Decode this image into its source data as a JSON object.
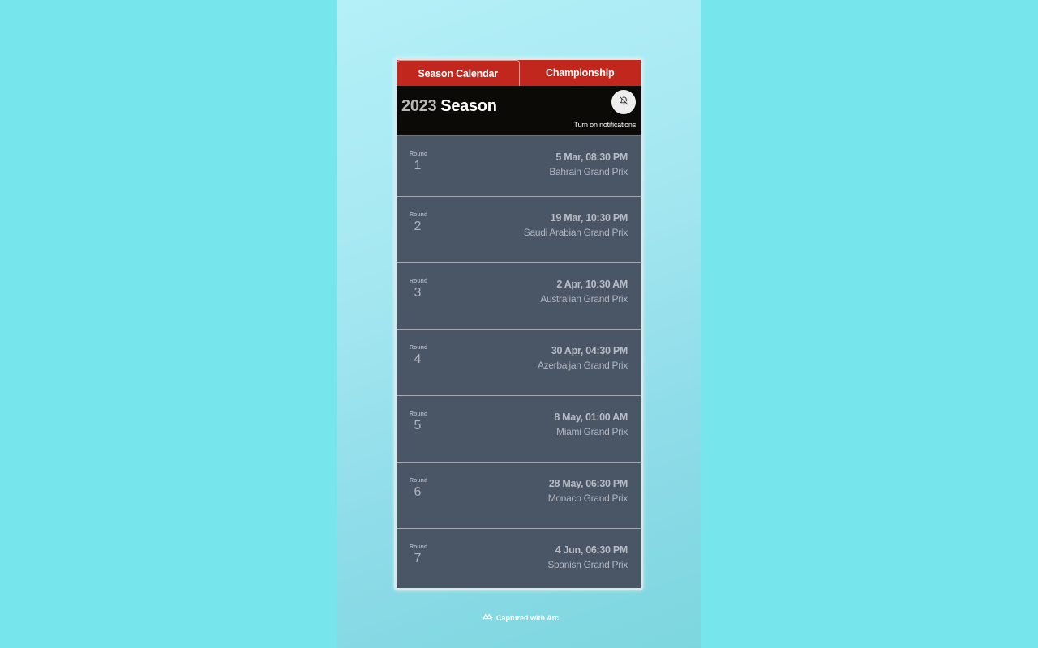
{
  "tabs": [
    {
      "label": "Season Calendar",
      "active": true
    },
    {
      "label": "Championship",
      "active": false
    }
  ],
  "header": {
    "year": "2023",
    "title_word": "Season",
    "notification_text": "Turn on notifications",
    "bell_icon": "bell-off-icon"
  },
  "round_label": "Round",
  "races": [
    {
      "round": "1",
      "date": "5 Mar, 08:30 PM",
      "name": "Bahrain Grand Prix"
    },
    {
      "round": "2",
      "date": "19 Mar, 10:30 PM",
      "name": "Saudi Arabian Grand Prix"
    },
    {
      "round": "3",
      "date": "2 Apr, 10:30 AM",
      "name": "Australian Grand Prix"
    },
    {
      "round": "4",
      "date": "30 Apr, 04:30 PM",
      "name": "Azerbaijan Grand Prix"
    },
    {
      "round": "5",
      "date": "8 May, 01:00 AM",
      "name": "Miami Grand Prix"
    },
    {
      "round": "6",
      "date": "28 May, 06:30 PM",
      "name": "Monaco Grand Prix"
    },
    {
      "round": "7",
      "date": "4 Jun, 06:30 PM",
      "name": "Spanish Grand Prix"
    }
  ],
  "footer": {
    "captured_text": "Captured with Arc"
  },
  "colors": {
    "accent": "#c1271d",
    "header_bg": "#0b0a06"
  }
}
